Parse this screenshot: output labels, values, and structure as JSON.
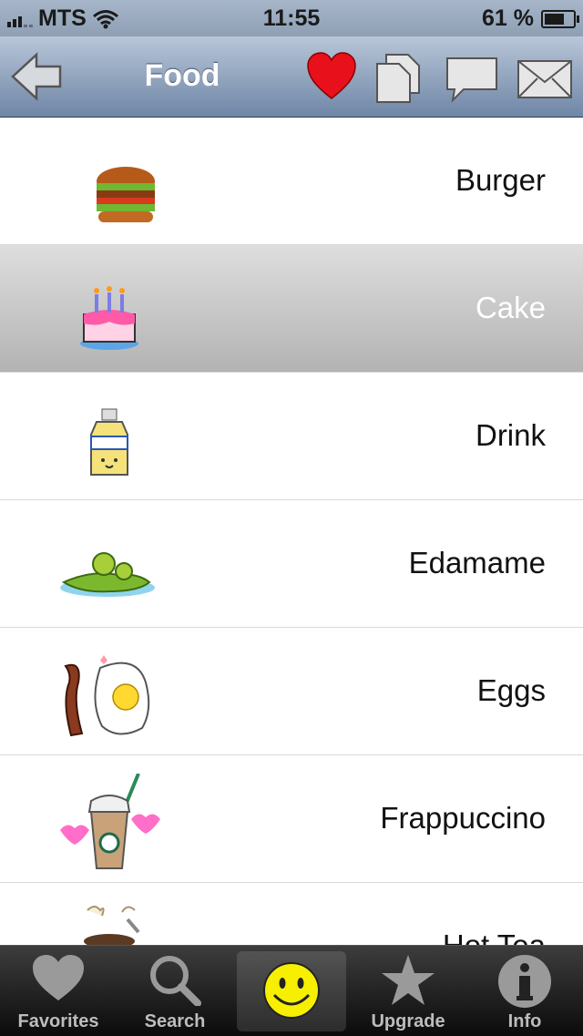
{
  "status_bar": {
    "carrier": "MTS",
    "time": "11:55",
    "battery": "61 %",
    "battery_level": 0.61
  },
  "nav": {
    "title": "Food",
    "back_icon": "back-arrow-icon",
    "actions": [
      "heart-icon",
      "copy-icon",
      "message-icon",
      "mail-icon"
    ]
  },
  "list": {
    "items": [
      {
        "label": "Burger",
        "icon": "burger-icon",
        "selected": false
      },
      {
        "label": "Cake",
        "icon": "cake-icon",
        "selected": true
      },
      {
        "label": "Drink",
        "icon": "drink-icon",
        "selected": false
      },
      {
        "label": "Edamame",
        "icon": "edamame-icon",
        "selected": false
      },
      {
        "label": "Eggs",
        "icon": "eggs-icon",
        "selected": false
      },
      {
        "label": "Frappuccino",
        "icon": "frappuccino-icon",
        "selected": false
      },
      {
        "label": "Hot Tea",
        "icon": "hot-tea-icon",
        "selected": false
      }
    ]
  },
  "tabs": [
    {
      "label": "Favorites",
      "icon": "heart-icon"
    },
    {
      "label": "Search",
      "icon": "magnifier-icon"
    },
    {
      "label": "",
      "icon": "smiley-icon",
      "active": true
    },
    {
      "label": "Upgrade",
      "icon": "star-icon"
    },
    {
      "label": "Info",
      "icon": "info-icon"
    }
  ],
  "colors": {
    "heart": "#e8101a",
    "nav_top": "#b8c6d8",
    "nav_bottom": "#6f86a6",
    "smiley": "#f7ef00"
  }
}
